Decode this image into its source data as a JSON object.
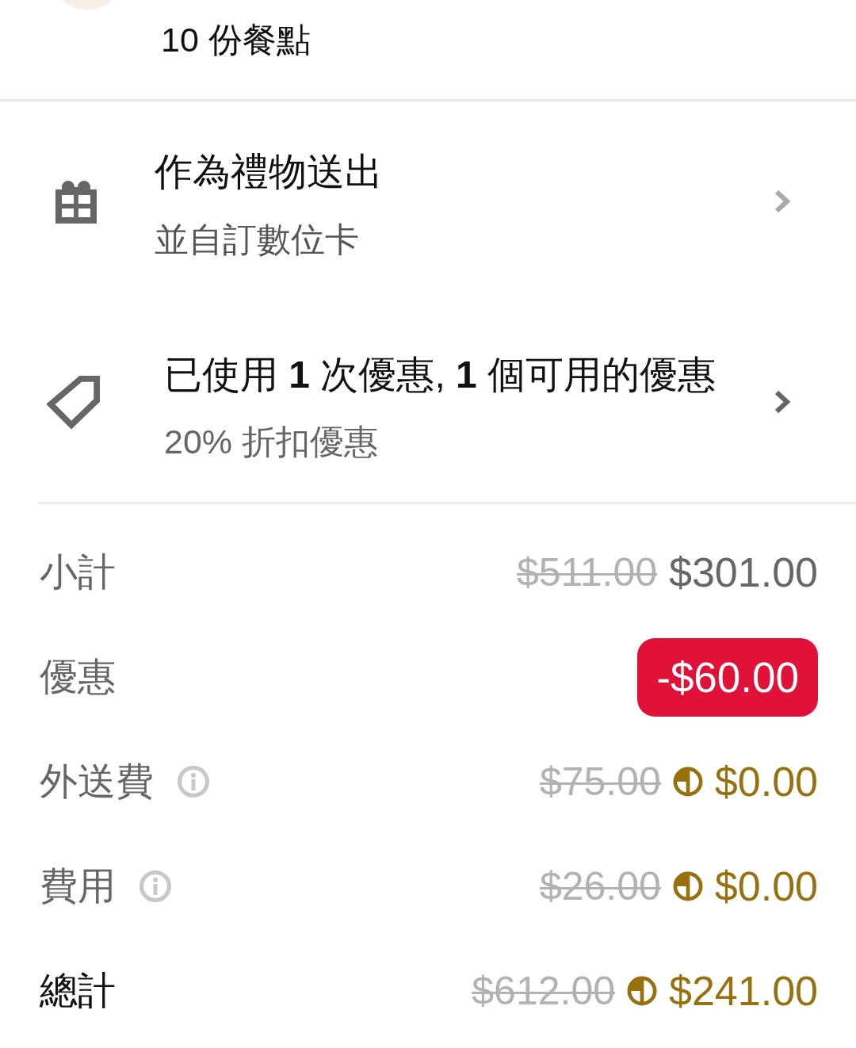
{
  "order_summary": {
    "item_count": "10 份餐點"
  },
  "options": [
    {
      "kind": "gift",
      "title": "作為禮物送出",
      "subtitle": "並自訂數位卡"
    },
    {
      "kind": "promo",
      "title": "已使用 **1** 次優惠, **1** 個可用的優惠",
      "subtitle": "20% 折扣優惠"
    }
  ],
  "price_rows": [
    {
      "kind": "subtotal",
      "label": "小計",
      "info_icon": false,
      "original_price": "$511.00",
      "price": "$301.00",
      "member_benefit": false
    },
    {
      "kind": "discount",
      "label": "優惠",
      "info_icon": false,
      "price": "-$60.00",
      "member_benefit": false
    },
    {
      "kind": "fee",
      "label": "外送費",
      "info_icon": true,
      "original_price": "$75.00",
      "price": "$0.00",
      "member_benefit": true
    },
    {
      "kind": "fee",
      "label": "費用",
      "info_icon": true,
      "original_price": "$26.00",
      "price": "$0.00",
      "member_benefit": true
    },
    {
      "kind": "total",
      "label": "總計",
      "info_icon": false,
      "original_price": "$612.00",
      "price": "$241.00",
      "member_benefit": true
    }
  ]
}
